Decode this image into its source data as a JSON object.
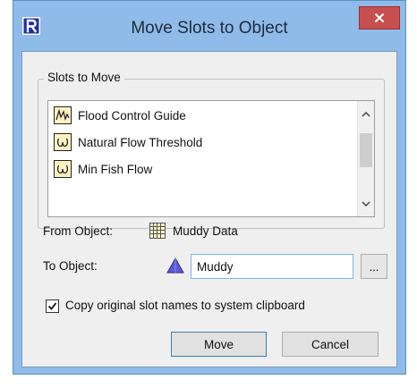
{
  "window": {
    "title": "Move Slots to Object"
  },
  "slots_group": {
    "label": "Slots to Move",
    "items": [
      {
        "label": "Flood Control Guide",
        "icon": "table-series-icon"
      },
      {
        "label": "Natural Flow Threshold",
        "icon": "omega-slot-icon"
      },
      {
        "label": "Min Fish Flow",
        "icon": "omega-slot-icon"
      }
    ]
  },
  "from_object": {
    "label": "From Object:",
    "value": "Muddy Data",
    "icon": "data-object-icon"
  },
  "to_object": {
    "label": "To Object:",
    "value": "Muddy",
    "icon": "reservoir-triangle-icon",
    "browse_label": "..."
  },
  "copy_names": {
    "label": "Copy original slot names to system clipboard",
    "checked": true
  },
  "buttons": {
    "move": "Move",
    "cancel": "Cancel"
  },
  "colors": {
    "title_bar": "#8fbbe8",
    "close_button": "#c84f4f",
    "dialog_bg": "#efefef",
    "slot_icon_fill": "#fff3c4",
    "triangle": "#5b5bd6"
  }
}
